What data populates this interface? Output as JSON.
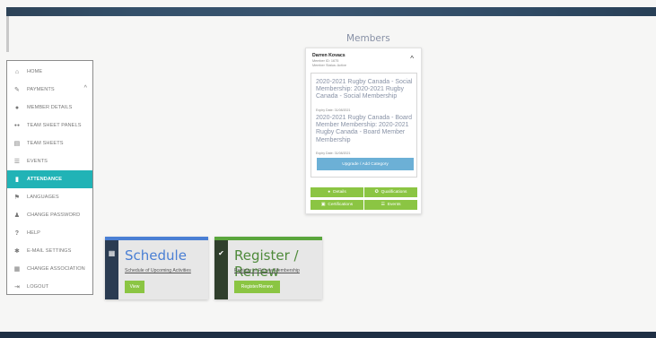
{
  "nav": {
    "items": [
      {
        "label": "HOME",
        "icon": "home-icon",
        "glyph": "⌂"
      },
      {
        "label": "PAYMENTS",
        "icon": "edit-icon",
        "glyph": "✎",
        "chevron": "^"
      },
      {
        "label": "MEMBER DETAILS",
        "icon": "user-icon",
        "glyph": "●"
      },
      {
        "label": "TEAM SHEET PANELS",
        "icon": "users-icon",
        "glyph": "●●"
      },
      {
        "label": "TEAM SHEETS",
        "icon": "clipboard-icon",
        "glyph": "▤"
      },
      {
        "label": "EVENTS",
        "icon": "list-icon",
        "glyph": "☰"
      },
      {
        "label": "ATTENDANCE",
        "icon": "clipboard-check-icon",
        "glyph": "▮"
      },
      {
        "label": "LANGUAGES",
        "icon": "flag-icon",
        "glyph": "⚑"
      },
      {
        "label": "CHANGE PASSWORD",
        "icon": "user-key-icon",
        "glyph": "♟"
      },
      {
        "label": "HELP",
        "icon": "question-icon",
        "glyph": "?"
      },
      {
        "label": "E-MAIL SETTINGS",
        "icon": "gear-icon",
        "glyph": "✱"
      },
      {
        "label": "CHANGE ASSOCIATION",
        "icon": "building-icon",
        "glyph": "▦"
      },
      {
        "label": "LOGOUT",
        "icon": "logout-icon",
        "glyph": "⇥"
      }
    ],
    "active": "ATTENDANCE"
  },
  "page": {
    "title": "Members"
  },
  "member": {
    "name": "Darren Kovacs",
    "id_line": "Member ID: 1675",
    "status_line": "Member Status: Active",
    "collapse_glyph": "^",
    "memberships": [
      {
        "title": "2020-2021 Rugby Canada - Social Membership: 2020-2021 Rugby Canada - Social Membership",
        "expiry": "Expiry Date: 31/08/2021"
      },
      {
        "title": "2020-2021 Rugby Canada - Board Member Membership: 2020-2021 Rugby Canada - Board Member Membership",
        "expiry": "Expiry Date: 31/08/2021"
      }
    ],
    "upgrade_label": "Upgrade / Add Category",
    "buttons": {
      "details": "Details",
      "qualifications": "Qualifications",
      "certifications": "Certifications",
      "events": "Events"
    }
  },
  "cards": {
    "schedule": {
      "title": "Schedule",
      "subtitle": "Schedule of Upcoming Activities",
      "button": "View",
      "accent": "#4a7fd4"
    },
    "register": {
      "title": "Register / Renew",
      "subtitle": "Register or Renew Membership",
      "button": "Register/Renew",
      "accent": "#5aa63c"
    }
  },
  "colors": {
    "active_nav": "#21b3b6",
    "green_button": "#8bc543",
    "upgrade_button": "#6cb0d6",
    "topbar": "#34506a"
  }
}
